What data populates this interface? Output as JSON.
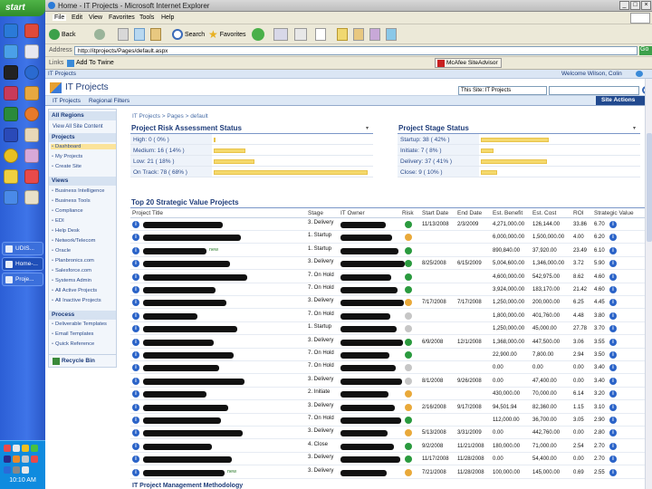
{
  "taskbar": {
    "start_label": "start",
    "buttons": [
      "UDIS...",
      "Home-...",
      "Proje..."
    ],
    "clock": "10:10 AM"
  },
  "window": {
    "title": "Home - IT Projects - Microsoft Internet Explorer",
    "menu": [
      "File",
      "Edit",
      "View",
      "Favorites",
      "Tools",
      "Help"
    ],
    "toolbar": {
      "back": "Back",
      "search": "Search",
      "favorites": "Favorites"
    },
    "address_label": "Address",
    "address_value": "http://itprojects/Pages/default.aspx",
    "go_label": "Go",
    "links_label": "Links",
    "add_to_twine": "Add To Twine",
    "mcafee": "McAfee SiteAdvisor"
  },
  "sharepoint": {
    "top_link": "IT Projects",
    "welcome": "Welcome Wilson, Colin",
    "site_title": "IT Projects",
    "nav": [
      "IT Projects",
      "Regional Filters"
    ],
    "search_scope": "This Site: IT Projects",
    "site_actions": "Site Actions",
    "breadcrumb": "IT Projects > Pages > default"
  },
  "leftnav": {
    "all_regions": "All Regions",
    "view_all": "View All Site Content",
    "projects_header": "Projects",
    "projects": [
      "Dashboard",
      "My Projects",
      "Create Site"
    ],
    "views_header": "Views",
    "views": [
      "Business Intelligence",
      "Business Tools",
      "Compliance",
      "EDI",
      "Help Desk",
      "Network/Telecom",
      "Oracle",
      "Planbronics.com",
      "Salesforce.com",
      "Systems Admin",
      "All Active Projects",
      "All Inactive Projects"
    ],
    "process_header": "Process",
    "process": [
      "Deliverable Templates",
      "Email Templates",
      "Quick Reference"
    ],
    "recycle": "Recycle Bin"
  },
  "risk_panel": {
    "title": "Project Risk Assessment Status",
    "rows": [
      {
        "label": "High: 0 ( 0% )",
        "pct": 0
      },
      {
        "label": "Medium: 16 ( 14% )",
        "pct": 14
      },
      {
        "label": "Low: 21 ( 18% )",
        "pct": 18
      },
      {
        "label": "On Track: 78 ( 68% )",
        "pct": 68
      }
    ]
  },
  "stage_panel": {
    "title": "Project Stage Status",
    "rows": [
      {
        "label": "Startup: 38 ( 42% )",
        "pct": 42
      },
      {
        "label": "Initiate: 7 ( 8% )",
        "pct": 8
      },
      {
        "label": "Delivery: 37 ( 41% )",
        "pct": 41
      },
      {
        "label": "Close: 9 ( 10% )",
        "pct": 10
      }
    ]
  },
  "table": {
    "title": "Top 20 Strategic Value Projects",
    "headers": [
      "Project Title",
      "Stage",
      "IT Owner",
      "Risk",
      "Start Date",
      "End Date",
      "Est. Benefit",
      "Est. Cost",
      "ROI",
      "Strategic Value"
    ],
    "rows": [
      {
        "stage": "3. Delivery",
        "risk": "green",
        "start": "11/13/2008",
        "end": "2/3/2009",
        "benefit": "4,271,000.00",
        "cost": "126,144.00",
        "roi": "33.86",
        "value": "6.70"
      },
      {
        "stage": "1. Startup",
        "risk": "yellow",
        "start": "",
        "end": "",
        "benefit": "6,000,000.00",
        "cost": "1,500,000.00",
        "roi": "4.00",
        "value": "6.20"
      },
      {
        "stage": "1. Startup",
        "risk": "green",
        "start": "",
        "end": "",
        "benefit": "890,840.00",
        "cost": "37,920.00",
        "roi": "23.49",
        "value": "6.10",
        "new": "new"
      },
      {
        "stage": "3. Delivery",
        "risk": "green",
        "start": "8/25/2008",
        "end": "6/15/2009",
        "benefit": "5,004,600.00",
        "cost": "1,346,000.00",
        "roi": "3.72",
        "value": "5.90"
      },
      {
        "stage": "7. On Hold",
        "risk": "green",
        "start": "",
        "end": "",
        "benefit": "4,600,000.00",
        "cost": "542,975.00",
        "roi": "8.62",
        "value": "4.60"
      },
      {
        "stage": "7. On Hold",
        "risk": "green",
        "start": "",
        "end": "",
        "benefit": "3,924,000.00",
        "cost": "183,170.00",
        "roi": "21.42",
        "value": "4.60"
      },
      {
        "stage": "3. Delivery",
        "risk": "yellow",
        "start": "7/17/2008",
        "end": "7/17/2008",
        "benefit": "1,250,000.00",
        "cost": "200,000.00",
        "roi": "6.25",
        "value": "4.45"
      },
      {
        "stage": "7. On Hold",
        "risk": "grey",
        "start": "",
        "end": "",
        "benefit": "1,800,000.00",
        "cost": "401,760.00",
        "roi": "4.48",
        "value": "3.80"
      },
      {
        "stage": "1. Startup",
        "risk": "grey",
        "start": "",
        "end": "",
        "benefit": "1,250,000.00",
        "cost": "45,000.00",
        "roi": "27.78",
        "value": "3.70"
      },
      {
        "stage": "3. Delivery",
        "risk": "green",
        "start": "6/9/2008",
        "end": "12/1/2008",
        "benefit": "1,368,000.00",
        "cost": "447,500.00",
        "roi": "3.06",
        "value": "3.55"
      },
      {
        "stage": "7. On Hold",
        "risk": "green",
        "start": "",
        "end": "",
        "benefit": "22,900.00",
        "cost": "7,800.00",
        "roi": "2.94",
        "value": "3.50"
      },
      {
        "stage": "7. On Hold",
        "risk": "grey",
        "start": "",
        "end": "",
        "benefit": "0.00",
        "cost": "0.00",
        "roi": "0.00",
        "value": "3.40"
      },
      {
        "stage": "3. Delivery",
        "risk": "grey",
        "start": "8/1/2008",
        "end": "9/26/2008",
        "benefit": "0.00",
        "cost": "47,400.00",
        "roi": "0.00",
        "value": "3.40"
      },
      {
        "stage": "2. Initiate",
        "risk": "yellow",
        "start": "",
        "end": "",
        "benefit": "430,000.00",
        "cost": "70,000.00",
        "roi": "6.14",
        "value": "3.20"
      },
      {
        "stage": "3. Delivery",
        "risk": "yellow",
        "start": "2/16/2008",
        "end": "9/17/2008",
        "benefit": "94,501.94",
        "cost": "82,360.00",
        "roi": "1.15",
        "value": "3.10"
      },
      {
        "stage": "7. On Hold",
        "risk": "green",
        "start": "",
        "end": "",
        "benefit": "112,000.00",
        "cost": "36,700.00",
        "roi": "3.05",
        "value": "2.90"
      },
      {
        "stage": "3. Delivery",
        "risk": "yellow",
        "start": "5/13/2008",
        "end": "3/31/2009",
        "benefit": "0.00",
        "cost": "442,760.00",
        "roi": "0.00",
        "value": "2.80"
      },
      {
        "stage": "4. Close",
        "risk": "green",
        "start": "9/2/2008",
        "end": "11/21/2008",
        "benefit": "180,000.00",
        "cost": "71,000.00",
        "roi": "2.54",
        "value": "2.70"
      },
      {
        "stage": "3. Delivery",
        "risk": "green",
        "start": "11/17/2008",
        "end": "11/28/2008",
        "benefit": "0.00",
        "cost": "54,400.00",
        "roi": "0.00",
        "value": "2.70"
      },
      {
        "stage": "3. Delivery",
        "risk": "yellow",
        "start": "7/21/2008",
        "end": "11/28/2008",
        "benefit": "100,000.00",
        "cost": "145,000.00",
        "roi": "0.69",
        "value": "2.55",
        "new": "new"
      }
    ]
  },
  "footer_text": "IT Project Management Methodology"
}
